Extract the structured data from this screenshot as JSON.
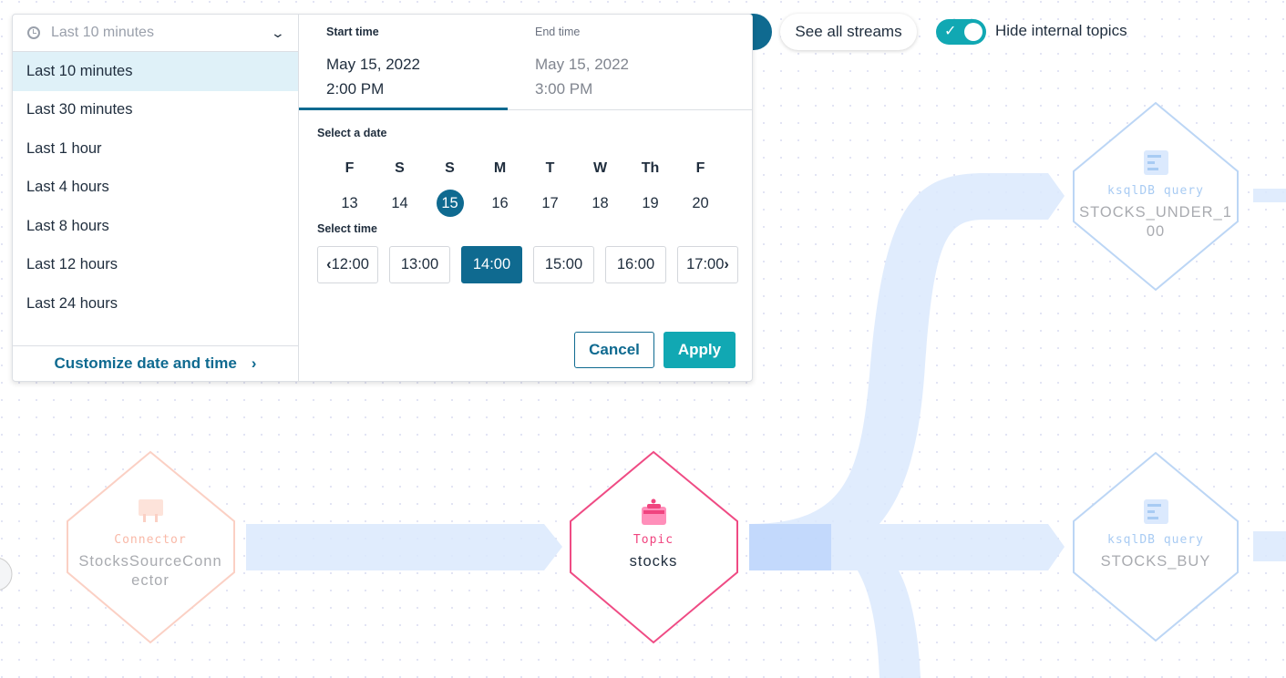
{
  "range_selector": {
    "current": "Last 10 minutes",
    "options": [
      "Last 10 minutes",
      "Last 30 minutes",
      "Last 1 hour",
      "Last 4 hours",
      "Last 8 hours",
      "Last 12 hours",
      "Last 24 hours"
    ],
    "customize_label": "Customize date and time"
  },
  "picker": {
    "start": {
      "label": "Start time",
      "date": "May 15, 2022",
      "time": "2:00 PM"
    },
    "end": {
      "label": "End time",
      "date": "May 15, 2022",
      "time": "3:00 PM"
    },
    "select_date_label": "Select a date",
    "days": [
      {
        "d": "F",
        "n": "13"
      },
      {
        "d": "S",
        "n": "14"
      },
      {
        "d": "S",
        "n": "15"
      },
      {
        "d": "M",
        "n": "16"
      },
      {
        "d": "T",
        "n": "17"
      },
      {
        "d": "W",
        "n": "18"
      },
      {
        "d": "Th",
        "n": "19"
      },
      {
        "d": "F",
        "n": "20"
      }
    ],
    "selected_day": "15",
    "select_time_label": "Select time",
    "times": [
      "12:00",
      "13:00",
      "14:00",
      "15:00",
      "16:00",
      "17:00"
    ],
    "selected_time": "14:00",
    "cancel": "Cancel",
    "apply": "Apply"
  },
  "toolbar": {
    "see_all_streams": "See all streams",
    "hide_internal_topics": "Hide internal topics",
    "hide_internal_enabled": true
  },
  "nodes": [
    {
      "type": "Connector",
      "name": "StocksSourceConnector",
      "name_lines": [
        "StocksSourceConn",
        "ector"
      ],
      "color": "#f9b9a8"
    },
    {
      "type": "Topic",
      "name": "stocks",
      "name_lines": [
        "stocks"
      ],
      "color": "#f0447f"
    },
    {
      "type": "ksqlDB query",
      "name": "STOCKS_UNDER_100",
      "name_lines": [
        "STOCKS_UNDER_1",
        "00"
      ],
      "color": "#a8cbf3"
    },
    {
      "type": "ksqlDB query",
      "name": "STOCKS_BUY",
      "name_lines": [
        "STOCKS_BUY"
      ],
      "color": "#a8cbf3"
    }
  ],
  "colors": {
    "accent": "#0f6a90",
    "teal": "#11a8b3",
    "flow": "#e0edfd"
  }
}
